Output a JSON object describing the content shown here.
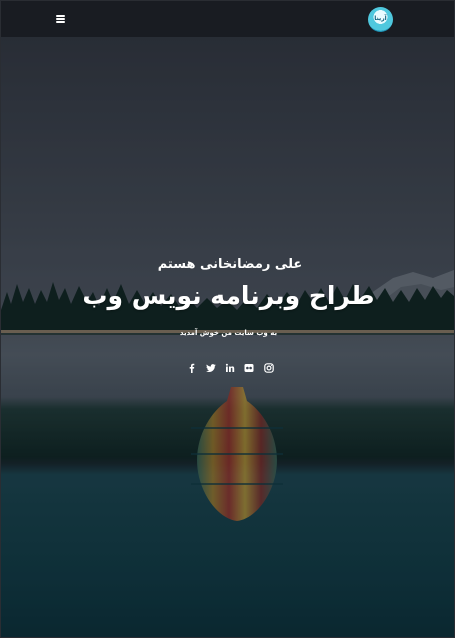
{
  "header": {
    "logo_text": "آرینا",
    "menu_icon": "hamburger-menu-icon"
  },
  "hero": {
    "subtitle": "علی رمضانخانی هستم",
    "title": "طراح وبرنامه نویس وب",
    "tagline": "به وب سایت من خوش آمدید"
  },
  "social_links": [
    {
      "name": "facebook",
      "icon": "facebook-icon"
    },
    {
      "name": "twitter",
      "icon": "twitter-icon"
    },
    {
      "name": "linkedin",
      "icon": "linkedin-icon"
    },
    {
      "name": "flickr",
      "icon": "flickr-icon"
    },
    {
      "name": "instagram",
      "icon": "instagram-icon"
    }
  ],
  "colors": {
    "header_bg": "#191c22",
    "text": "#ffffff",
    "logo_accent": "#4fc8de"
  }
}
